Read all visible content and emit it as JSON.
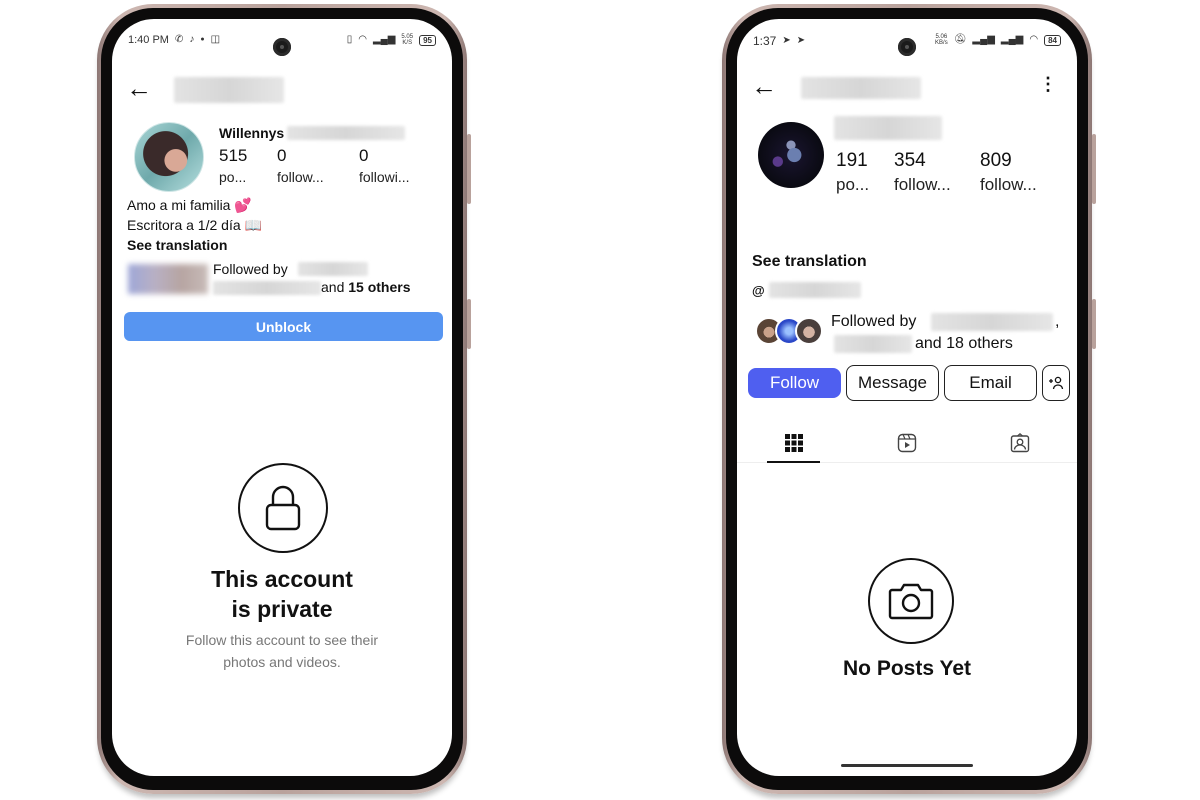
{
  "left_phone": {
    "status_bar": {
      "time": "1:40 PM",
      "left_icons": [
        "whatsapp-icon",
        "tiktok-icon",
        "notification-dot-icon",
        "instagram-icon"
      ],
      "right_icons": [
        "vibrate-icon",
        "wifi-icon",
        "signal-icon"
      ],
      "net_speed_top": "5.05",
      "net_speed_unit": "K/S",
      "battery": "95"
    },
    "header": {
      "back_icon": "←"
    },
    "profile": {
      "username_visible": "Willennys",
      "stats": [
        {
          "value": "515",
          "label": "po..."
        },
        {
          "value": "0",
          "label": "follow..."
        },
        {
          "value": "0",
          "label": "followi..."
        }
      ],
      "bio_lines": [
        "Amo a mi familia 💕",
        "Escritora a 1/2 día 📖"
      ],
      "see_translation": "See translation",
      "followed_by_prefix": "Followed by",
      "followed_by_suffix_and": "and",
      "followed_by_count": "15 others"
    },
    "unblock_label": "Unblock",
    "private_notice": {
      "title_line1": "This account",
      "title_line2": "is private",
      "subtitle": "Follow this account to see their photos and videos."
    }
  },
  "right_phone": {
    "status_bar": {
      "time": "1:37",
      "left_icons": [
        "telegram-icon",
        "telegram-icon"
      ],
      "net_speed_top": "5.06",
      "net_speed_unit": "KB/s",
      "right_icons": [
        "mute-icon",
        "signal-icon",
        "signal-icon",
        "wifi-icon"
      ],
      "battery": "84"
    },
    "header": {
      "back_icon": "←",
      "more_icon": "⋮"
    },
    "profile": {
      "stats": [
        {
          "value": "191",
          "label": "po..."
        },
        {
          "value": "354",
          "label": "follow..."
        },
        {
          "value": "809",
          "label": "follow..."
        }
      ],
      "see_translation": "See translation",
      "threads_icon": "@",
      "followed_by_prefix": "Followed by",
      "followed_by_comma": ",",
      "followed_by_suffix_and": "and",
      "followed_by_count": "18 others"
    },
    "buttons": {
      "follow": "Follow",
      "message": "Message",
      "email": "Email",
      "add_user": "+👤"
    },
    "tabs": [
      {
        "name": "grid",
        "active": true
      },
      {
        "name": "reels",
        "active": false
      },
      {
        "name": "tagged",
        "active": false
      }
    ],
    "empty_state": {
      "title": "No Posts Yet"
    }
  },
  "colors": {
    "unblock_blue": "#5795f1",
    "follow_blue": "#4f5ff0",
    "frame_bronze": "#b9a29c"
  }
}
